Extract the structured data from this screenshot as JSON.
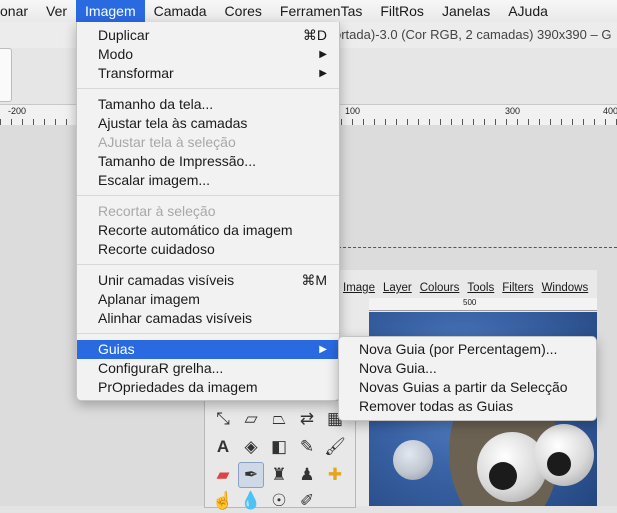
{
  "menubar": {
    "items": [
      "onar",
      "Ver",
      "Imagem",
      "Camada",
      "Cores",
      "FerramenTas",
      "FiltRos",
      "Janelas",
      "AJuda"
    ]
  },
  "window": {
    "title_fragment": "ortada)-3.0 (Cor RGB, 2 camadas) 390x390 – G"
  },
  "ruler": {
    "labels": [
      "-200",
      "100",
      "300",
      "400"
    ]
  },
  "inner": {
    "menu": [
      "Image",
      "Layer",
      "Colours",
      "Tools",
      "Filters",
      "Windows"
    ],
    "ruler_label": "500"
  },
  "image_menu": {
    "duplicar": {
      "label": "Duplicar",
      "shortcut": "⌘D"
    },
    "modo": "Modo",
    "transformar": "Transformar",
    "tamanho_tela": "Tamanho da tela...",
    "ajustar_camadas": "Ajustar tela às camadas",
    "ajustar_selecao": "AJustar tela à seleção",
    "tamanho_impressao": "Tamanho de Impressão...",
    "escalar": "Escalar imagem...",
    "recortar_selecao": "Recortar à seleção",
    "recorte_automatico": "Recorte automático da imagem",
    "recorte_cuidadoso": "Recorte cuidadoso",
    "unir": {
      "label": "Unir camadas visíveis",
      "shortcut": "⌘M"
    },
    "aplanar": "Aplanar imagem",
    "alinhar": "Alinhar camadas visíveis",
    "guias": "Guias",
    "grelha": "ConfiguraR grelha...",
    "propriedades": "PrOpriedades da imagem",
    "arrow": "▶"
  },
  "guias_submenu": [
    "Nova Guia (por Percentagem)...",
    "Nova Guia...",
    "Novas Guias a partir da Selecção",
    "Remover todas as Guias"
  ],
  "colors": {
    "highlight": "#2a6ae0"
  }
}
